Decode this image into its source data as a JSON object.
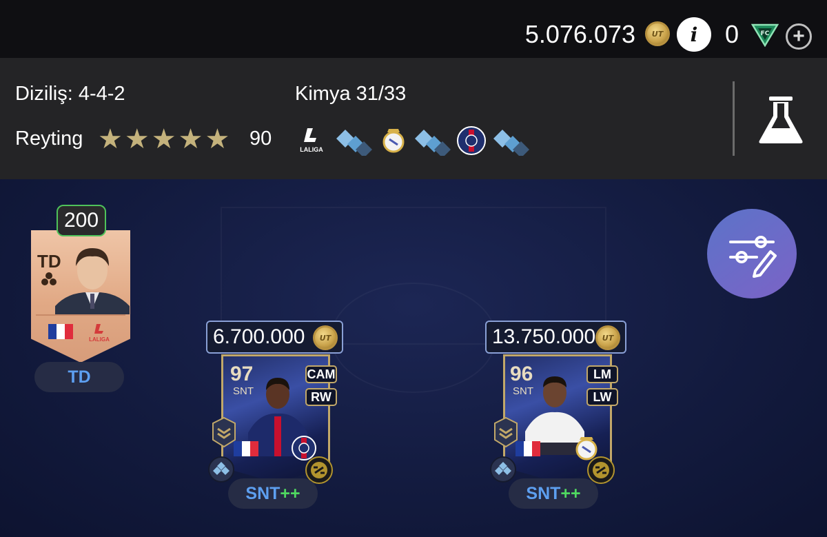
{
  "currency": {
    "coins": "5.076.073",
    "coin_icon": "coin-icon",
    "coin_label": "UT",
    "points": "0",
    "points_icon": "fc-points-icon",
    "add_icon": "plus-icon"
  },
  "squad": {
    "formation_label": "Diziliş: 4-4-2",
    "chemistry_label": "Kimya 31/33",
    "rating_label": "Reyting",
    "rating_stars": 5,
    "rating_value": "90",
    "chemistry_icons": [
      "laliga-logo",
      "chemistry-diamonds-icon",
      "real-madrid-crest",
      "chemistry-diamonds-icon",
      "psg-crest",
      "chemistry-diamonds-icon"
    ],
    "laliga_text": "LALIGA"
  },
  "manager": {
    "rating": "200",
    "position": "TD",
    "pill_label": "TD",
    "nation_flag": "france-flag",
    "league": "LALIGA"
  },
  "players": [
    {
      "price": "6.700.000",
      "coin_label": "UT",
      "ovr": "97",
      "pos": "SNT",
      "alt_positions": [
        "CAM",
        "RW"
      ],
      "pill_pos": "SNT",
      "pill_plus": "++",
      "club": "psg-crest",
      "nation": "france-flag"
    },
    {
      "price": "13.750.000",
      "coin_label": "UT",
      "ovr": "96",
      "pos": "SNT",
      "alt_positions": [
        "LM",
        "LW"
      ],
      "pill_pos": "SNT",
      "pill_plus": "++",
      "club": "real-madrid-crest",
      "nation": "france-flag"
    }
  ],
  "colors": {
    "topbar_bg": "#0f0f12",
    "panel_bg": "#242426",
    "star_gold": "#c4b27c",
    "rating_border_green": "#4fc35a",
    "pill_blue": "#5d9ff0",
    "pill_green": "#4fd860",
    "edit_button_gradient_start": "#5c73c9",
    "edit_button_gradient_end": "#7b63c6"
  },
  "edit_button_icon": "edit-squad-sliders-icon",
  "lab_icon": "flask-icon"
}
